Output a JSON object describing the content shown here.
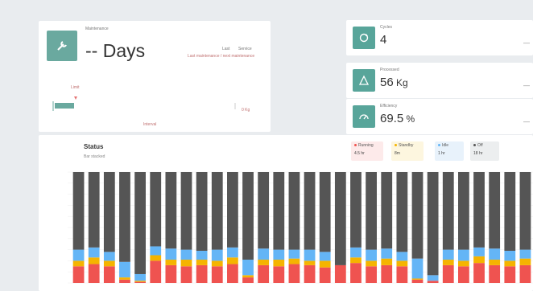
{
  "maintenance": {
    "title": "Maintenance",
    "value": "-- Days",
    "header_right_1": "Last",
    "header_right_2": "Service",
    "header_right_3": "Last maintenance / next maintenance",
    "marker_label": "Limit",
    "scale_right": "0 Kg",
    "scale_bottom": "Interval"
  },
  "kpis": [
    {
      "label": "Cycles",
      "value": "4",
      "unit": "",
      "icon": "cycle-icon"
    },
    {
      "label": "Processed",
      "value": "56",
      "unit": " Kg",
      "icon": "triangle-warning-icon"
    },
    {
      "label": "Efficiency",
      "value": "69.5",
      "unit": " %",
      "icon": "gauge-icon"
    }
  ],
  "status": {
    "title": "Status",
    "subtitle": "Bar stacked",
    "legend": [
      {
        "name": "Running",
        "value": "4.5 hr",
        "color": "#ef5350",
        "bg": "#fdeaea"
      },
      {
        "name": "Standby",
        "value": "8m",
        "color": "#f5b400",
        "bg": "#fdf6df"
      },
      {
        "name": "Idle",
        "value": "1 hr",
        "color": "#64b5f6",
        "bg": "#e8f2fb"
      },
      {
        "name": "Off",
        "value": "18 hr",
        "color": "#555555",
        "bg": "#eceeef"
      }
    ]
  },
  "chart_data": {
    "type": "bar",
    "stacked": true,
    "ylim": [
      0,
      100
    ],
    "series": [
      {
        "name": "Running",
        "color": "#ef5350",
        "values": [
          15,
          17,
          15,
          3,
          1,
          20,
          16,
          15,
          16,
          15,
          17,
          5,
          16,
          15,
          17,
          16,
          14,
          16,
          18,
          15,
          16,
          15,
          3,
          2,
          16,
          15,
          18,
          16,
          15,
          16
        ]
      },
      {
        "name": "Standby",
        "color": "#f5b400",
        "values": [
          5,
          6,
          5,
          2,
          1,
          5,
          5,
          6,
          5,
          5,
          6,
          2,
          5,
          6,
          5,
          4,
          6,
          0,
          5,
          5,
          6,
          5,
          1,
          0,
          5,
          5,
          6,
          5,
          5,
          6
        ]
      },
      {
        "name": "Idle",
        "color": "#64b5f6",
        "values": [
          10,
          9,
          8,
          14,
          6,
          8,
          10,
          9,
          8,
          10,
          9,
          14,
          10,
          9,
          8,
          10,
          8,
          0,
          9,
          10,
          9,
          8,
          18,
          5,
          9,
          10,
          8,
          10,
          9,
          8
        ]
      },
      {
        "name": "Off",
        "color": "#555555",
        "values": [
          70,
          68,
          72,
          81,
          92,
          67,
          69,
          70,
          71,
          70,
          68,
          79,
          69,
          70,
          70,
          70,
          72,
          84,
          68,
          70,
          69,
          72,
          78,
          93,
          70,
          70,
          68,
          69,
          71,
          70
        ]
      }
    ]
  }
}
